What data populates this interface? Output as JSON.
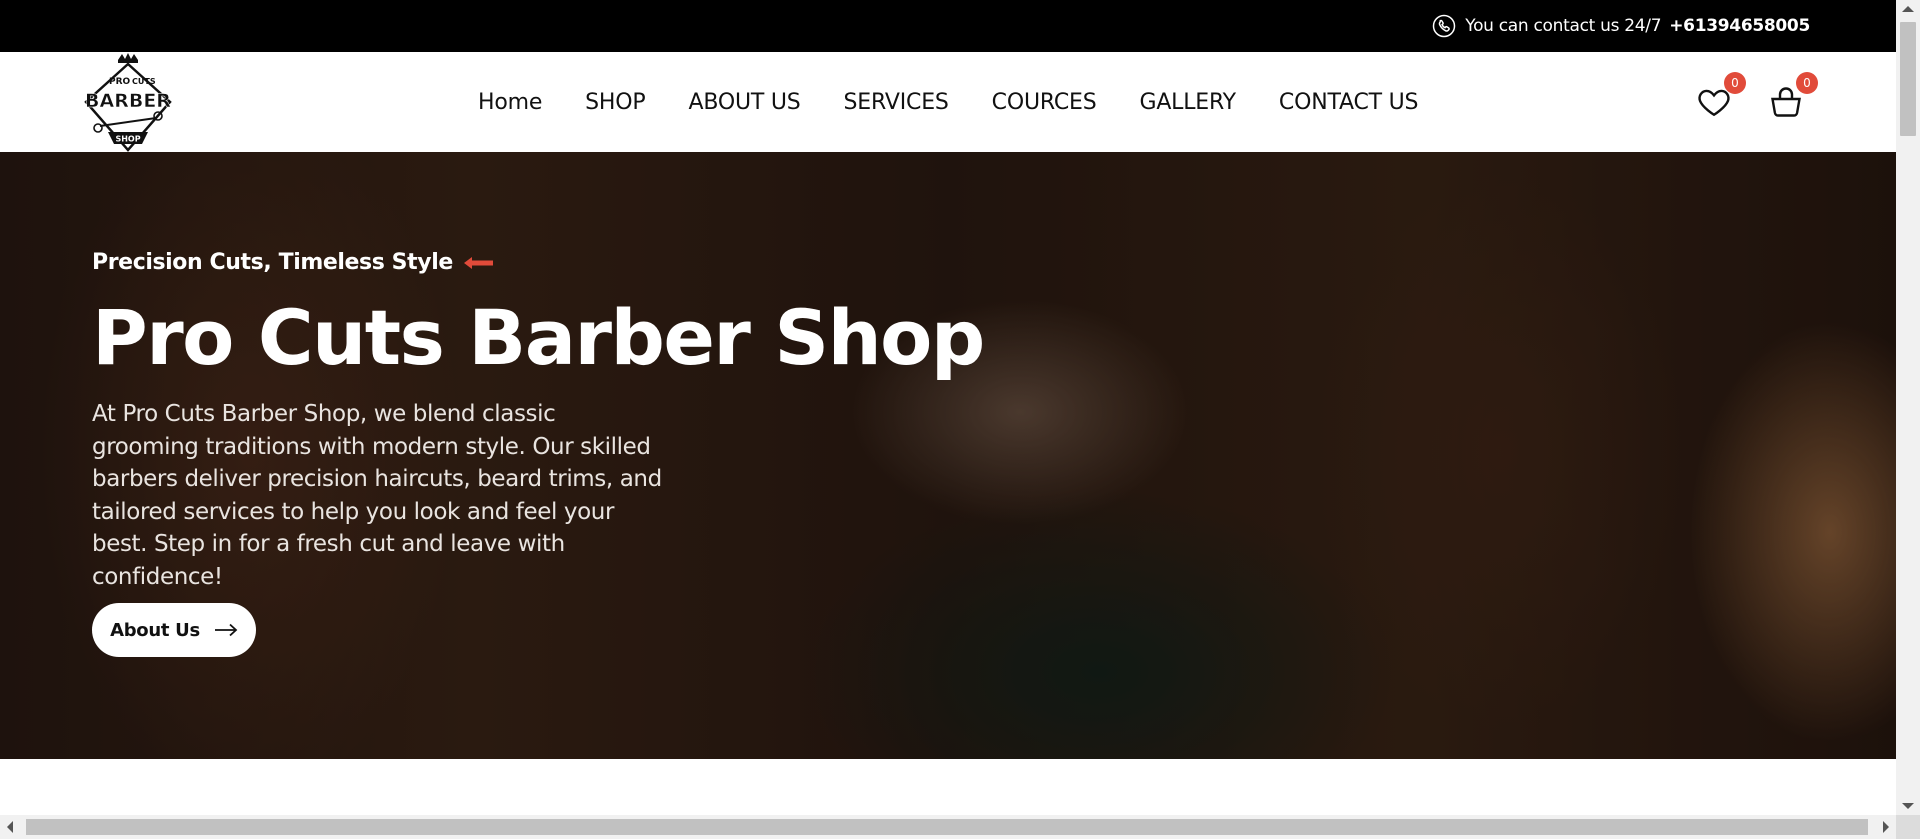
{
  "topbar": {
    "contact_text": "You can contact us 24/7",
    "phone_number": "+61394658005"
  },
  "logo": {
    "line1_left": "PRO",
    "line1_right": "CUTS",
    "line2": "BARBER",
    "line3": "SHOP"
  },
  "nav": {
    "items": [
      {
        "label": "Home"
      },
      {
        "label": "SHOP"
      },
      {
        "label": "ABOUT US"
      },
      {
        "label": "SERVICES"
      },
      {
        "label": "COURCES"
      },
      {
        "label": "GALLERY"
      },
      {
        "label": "CONTACT US"
      }
    ]
  },
  "header_icons": {
    "wishlist_count": "0",
    "cart_count": "0",
    "badge_color": "#e14b3a"
  },
  "hero": {
    "tagline": "Precision Cuts, Timeless Style",
    "title": "Pro Cuts Barber Shop",
    "description": "At Pro Cuts Barber Shop, we blend classic grooming traditions with modern style. Our skilled barbers deliver precision haircuts, beard trims, and tailored services to help you look and feel your best. Step in for a fresh cut and leave with confidence!",
    "button_label": "About Us",
    "accent_color": "#e14b3a"
  }
}
